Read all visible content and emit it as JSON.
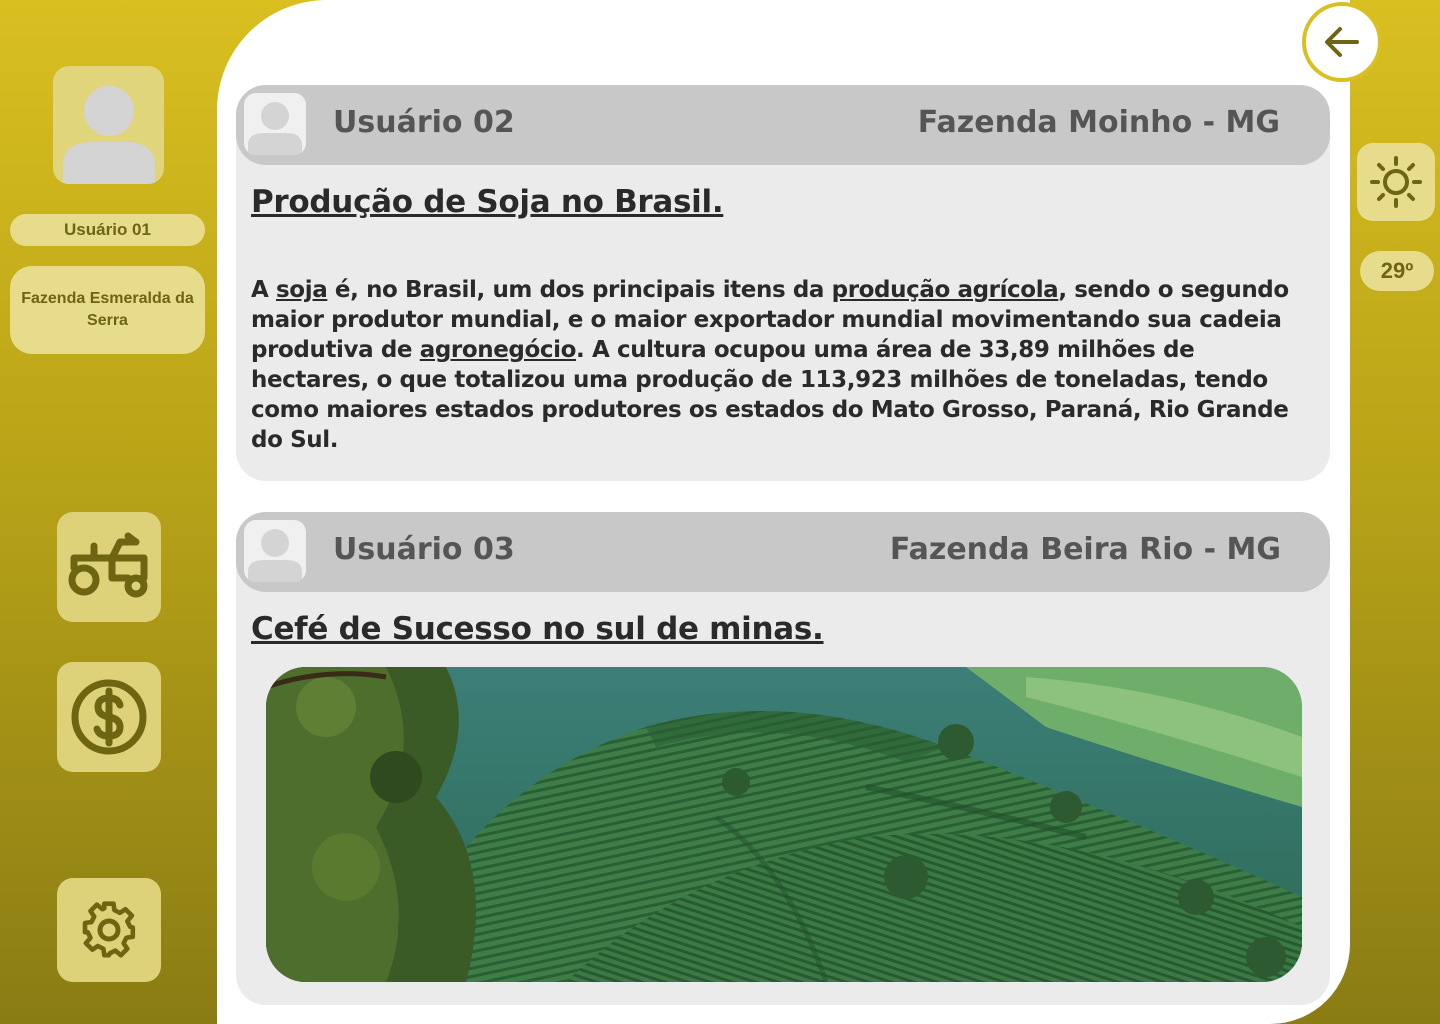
{
  "sidebar": {
    "user_label": "Usuário 01",
    "farm_label": "Fazenda Esmeralda da Serra",
    "nav": [
      {
        "name": "tractor-icon"
      },
      {
        "name": "money-icon"
      },
      {
        "name": "gear-icon"
      }
    ]
  },
  "weather": {
    "icon": "sun-icon",
    "temperature": "29º"
  },
  "colors": {
    "accent": "#d9bf20",
    "accent_dark": "#6e6512",
    "pill": "#e6dc8c",
    "card": "#ebebeb",
    "card_header": "#c8c8c8"
  },
  "posts": [
    {
      "user": "Usuário 02",
      "farm": "Fazenda Moinho - MG",
      "title": "Produção de Soja no Brasil.",
      "body": {
        "p1": "A ",
        "link1": "soja",
        "p2": " é, no Brasil, um dos principais itens da ",
        "link2": "produção agrícola",
        "p3": ", sendo o segundo maior produtor mundial, e o maior exportador mundial movimentando sua cadeia produtiva de ",
        "link3": "agronegócio",
        "p4": ". A cultura ocupou uma área de 33,89 milhões de hectares, o que totalizou uma produção de 113,923 milhões de toneladas, tendo como maiores estados produtores os estados do Mato Grosso, Paraná, Rio Grande do Sul."
      }
    },
    {
      "user": "Usuário 03",
      "farm": "Fazenda Beira Rio - MG",
      "title": "Cefé de Sucesso no sul de minas."
    }
  ]
}
